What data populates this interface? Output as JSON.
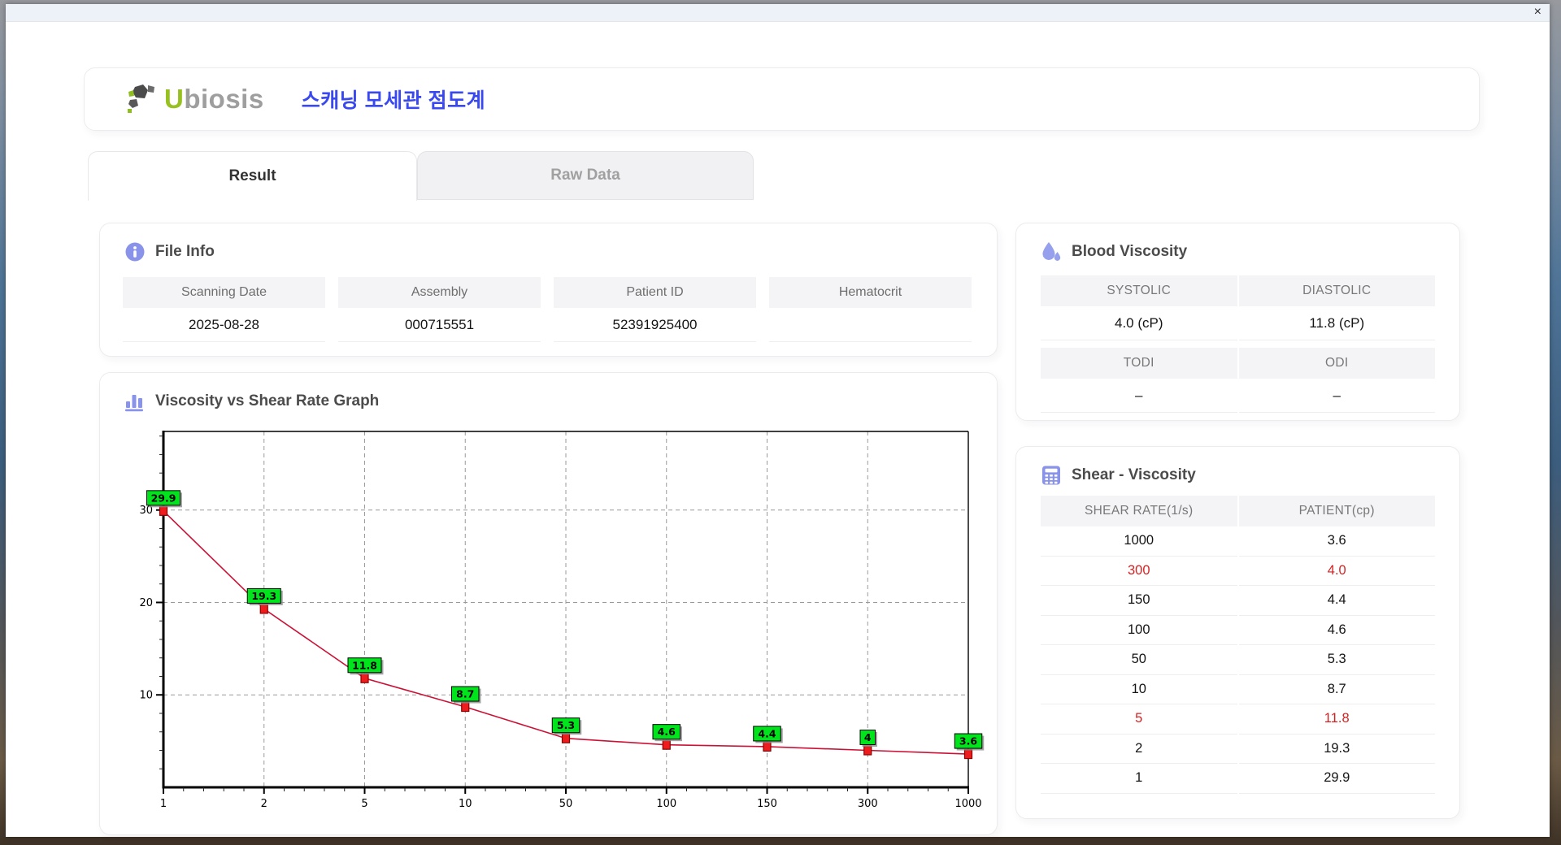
{
  "window": {
    "close_label": "×"
  },
  "header": {
    "logo_text_u": "U",
    "logo_text_rest": "biosis",
    "app_title_korean": "스캐닝 모세관 점도계",
    "title_color": "#3a49ef",
    "logo_green": "#97c11f",
    "accent_purple": "#8a93ea"
  },
  "tabs": [
    {
      "label": "Result",
      "active": true
    },
    {
      "label": "Raw Data",
      "active": false
    }
  ],
  "file_info": {
    "title": "File Info",
    "fields": [
      {
        "label": "Scanning Date",
        "value": "2025-08-28"
      },
      {
        "label": "Assembly",
        "value": "000715551"
      },
      {
        "label": "Patient ID",
        "value": "52391925400"
      },
      {
        "label": "Hematocrit",
        "value": ""
      }
    ]
  },
  "graph": {
    "title": "Viscosity vs Shear Rate Graph"
  },
  "chart_data": {
    "type": "line",
    "title": "Viscosity vs Shear Rate Graph",
    "categories": [
      "1",
      "2",
      "5",
      "10",
      "50",
      "100",
      "150",
      "300",
      "1000"
    ],
    "values": [
      29.9,
      19.3,
      11.8,
      8.7,
      5.3,
      4.6,
      4.4,
      4,
      3.6
    ],
    "point_labels": [
      "29.9",
      "19.3",
      "11.8",
      "8.7",
      "5.3",
      "4.6",
      "4.4",
      "4",
      "3.6"
    ],
    "xlabel": "",
    "ylabel": "",
    "yticks": [
      10,
      20,
      30
    ],
    "ylim": [
      0,
      38.5
    ],
    "grid": "dashed",
    "legend": "none",
    "line_color": "#cb1236",
    "marker_color": "#ee1c1c",
    "marker_border": "#8c0000",
    "label_bg": "#00e41c",
    "label_border": "#000000"
  },
  "blood_viscosity": {
    "title": "Blood Viscosity",
    "groups": [
      [
        {
          "label": "SYSTOLIC",
          "value": "4.0 (cP)"
        },
        {
          "label": "DIASTOLIC",
          "value": "11.8 (cP)"
        }
      ],
      [
        {
          "label": "TODI",
          "value": "–"
        },
        {
          "label": "ODI",
          "value": "–"
        }
      ]
    ]
  },
  "shear_viscosity": {
    "title": "Shear - Viscosity",
    "columns": [
      "SHEAR RATE(1/s)",
      "PATIENT(cp)"
    ],
    "highlight_color": "#d42222",
    "rows": [
      {
        "shear_rate": "1000",
        "patient": "3.6",
        "highlight": false
      },
      {
        "shear_rate": "300",
        "patient": "4.0",
        "highlight": true
      },
      {
        "shear_rate": "150",
        "patient": "4.4",
        "highlight": false
      },
      {
        "shear_rate": "100",
        "patient": "4.6",
        "highlight": false
      },
      {
        "shear_rate": "50",
        "patient": "5.3",
        "highlight": false
      },
      {
        "shear_rate": "10",
        "patient": "8.7",
        "highlight": false
      },
      {
        "shear_rate": "5",
        "patient": "11.8",
        "highlight": true
      },
      {
        "shear_rate": "2",
        "patient": "19.3",
        "highlight": false
      },
      {
        "shear_rate": "1",
        "patient": "29.9",
        "highlight": false
      }
    ]
  }
}
